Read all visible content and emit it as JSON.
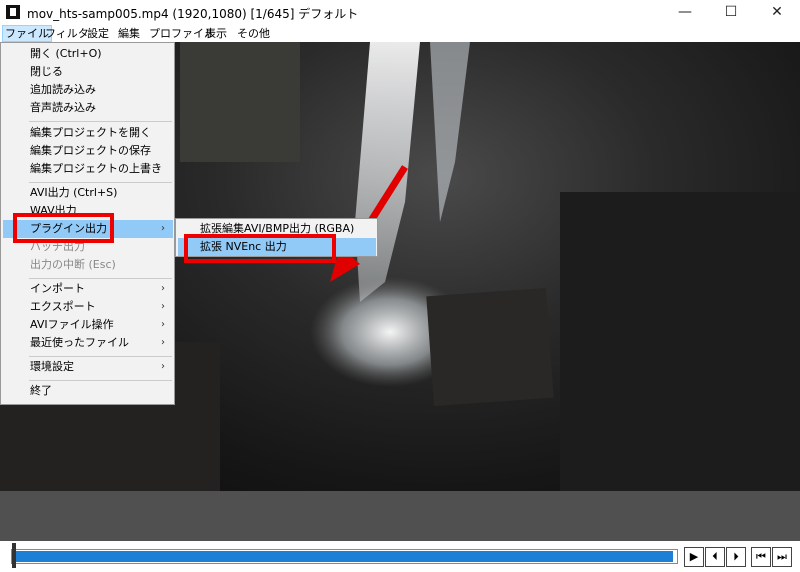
{
  "window": {
    "title": "mov_hts-samp005.mp4 (1920,1080)  [1/645]  デフォルト",
    "minimize": "—",
    "maximize": "☐",
    "close": "✕"
  },
  "menubar": [
    "ファイル",
    "フィルタ",
    "設定",
    "編集",
    "プロファイル",
    "表示",
    "その他"
  ],
  "file_menu": [
    {
      "label": "開く (Ctrl+O)"
    },
    {
      "label": "閉じる"
    },
    {
      "label": "追加読み込み"
    },
    {
      "label": "音声読み込み"
    },
    {
      "label": "編集プロジェクトを開く"
    },
    {
      "label": "編集プロジェクトの保存"
    },
    {
      "label": "編集プロジェクトの上書き"
    },
    {
      "label": "AVI出力 (Ctrl+S)"
    },
    {
      "label": "WAV出力"
    },
    {
      "label": "プラグイン出力",
      "arrow": "›"
    },
    {
      "label": "バッチ出力"
    },
    {
      "label": "出力の中断 (Esc)"
    },
    {
      "label": "インポート",
      "arrow": "›"
    },
    {
      "label": "エクスポート",
      "arrow": "›"
    },
    {
      "label": "AVIファイル操作",
      "arrow": "›"
    },
    {
      "label": "最近使ったファイル",
      "arrow": "›"
    },
    {
      "label": "環境設定",
      "arrow": "›"
    },
    {
      "label": "終了"
    }
  ],
  "plugin_submenu": [
    {
      "label": "拡張編集AVI/BMP出力 (RGBA)"
    },
    {
      "label": "拡張 NVEnc 出力"
    }
  ],
  "colors": {
    "highlight": "#91c9f7",
    "annotation": "#e00000",
    "progress": "#1e7fd6"
  },
  "playback": {
    "progress_fraction": 0.995,
    "controls": [
      {
        "name": "play-icon",
        "glyph": "▶"
      },
      {
        "name": "step-back-icon",
        "glyph": "⏴"
      },
      {
        "name": "step-forward-icon",
        "glyph": "⏵"
      },
      {
        "name": "jump-start-icon",
        "glyph": "⏮"
      },
      {
        "name": "jump-end-icon",
        "glyph": "⏭"
      }
    ]
  }
}
